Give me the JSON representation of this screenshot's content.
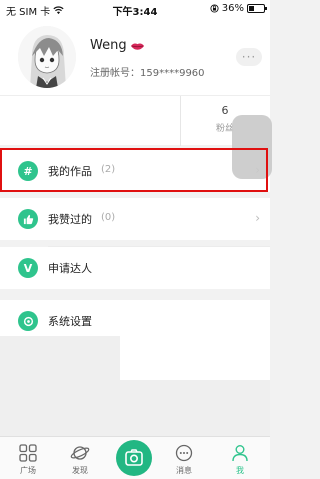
{
  "status_bar": {
    "carrier": "无 SIM 卡",
    "time": "下午3:44",
    "battery": "36%",
    "battery_level": 0.36
  },
  "profile": {
    "username": "Weng",
    "account": "注册帐号：159****9960"
  },
  "stats": {
    "fans_count": "6",
    "fans_label": "粉丝"
  },
  "menu": [
    {
      "label": "我的作品",
      "count": "(2)",
      "icon": "hash-icon"
    },
    {
      "label": "我赞过的",
      "count": "(0)",
      "icon": "thumbs-up-icon"
    },
    {
      "label": "申请达人",
      "count": "",
      "icon": "v-badge-icon"
    },
    {
      "label": "系统设置",
      "count": "",
      "icon": "settings-icon"
    }
  ],
  "tabs": [
    {
      "label": "广场",
      "icon": "grid-icon"
    },
    {
      "label": "发现",
      "icon": "planet-icon"
    },
    {
      "label": "",
      "icon": "camera-icon"
    },
    {
      "label": "消息",
      "icon": "chat-bubble-icon"
    },
    {
      "label": "我",
      "icon": "person-icon",
      "active": true
    }
  ],
  "colors": {
    "accent": "#2fc48d",
    "highlight": "#e01010"
  }
}
